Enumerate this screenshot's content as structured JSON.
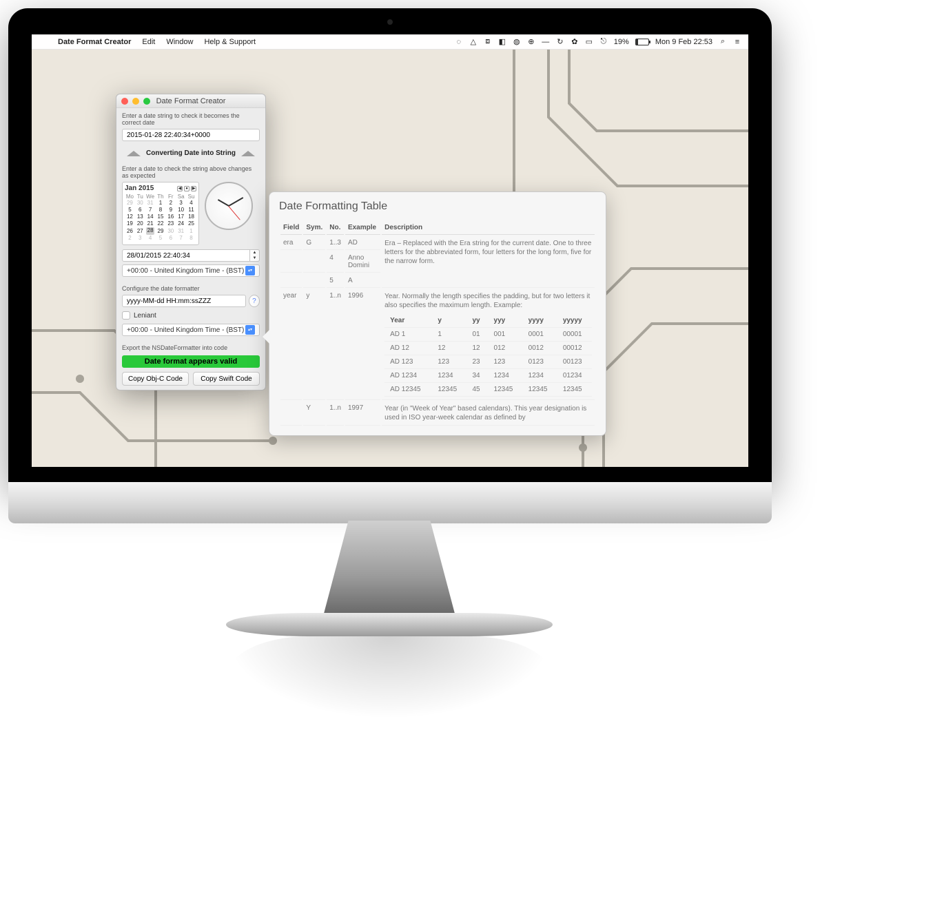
{
  "menubar": {
    "app_name": "Date Format Creator",
    "items": [
      "Edit",
      "Window",
      "Help & Support"
    ],
    "battery_pct": "19%",
    "datetime": "Mon 9 Feb  22:53"
  },
  "window": {
    "title": "Date Format Creator",
    "check_label": "Enter a date string to check it becomes the correct date",
    "check_value": "2015-01-28 22:40:34+0000",
    "divider_label": "Converting Date into String",
    "enter_date_label": "Enter a date to check the string above changes as expected",
    "calendar": {
      "month": "Jan 2015",
      "dow": [
        "Mo",
        "Tu",
        "We",
        "Th",
        "Fr",
        "Sa",
        "Su"
      ],
      "weeks": [
        [
          "29",
          "30",
          "31",
          "1",
          "2",
          "3",
          "4"
        ],
        [
          "5",
          "6",
          "7",
          "8",
          "9",
          "10",
          "11"
        ],
        [
          "12",
          "13",
          "14",
          "15",
          "16",
          "17",
          "18"
        ],
        [
          "19",
          "20",
          "21",
          "22",
          "23",
          "24",
          "25"
        ],
        [
          "26",
          "27",
          "28",
          "29",
          "30",
          "31",
          "1"
        ],
        [
          "2",
          "3",
          "4",
          "5",
          "6",
          "7",
          "8"
        ]
      ],
      "dim_leading": 3,
      "dim_trailing_start": 33,
      "selected": "28"
    },
    "date_value": "28/01/2015 22:40:34",
    "timezone1": "+00:00 - United Kingdom Time - (BST)",
    "configure_label": "Configure the date formatter",
    "format_value": "yyyy-MM-dd HH:mm:ssZZZ",
    "leniant_label": "Leniant",
    "timezone2": "+00:00 - United Kingdom Time - (BST)",
    "export_label": "Export the NSDateFormatter into code",
    "valid_label": "Date format appears valid",
    "copy_objc": "Copy Obj-C Code",
    "copy_swift": "Copy Swift Code"
  },
  "popover": {
    "title": "Date Formatting Table",
    "headers": {
      "field": "Field",
      "sym": "Sym.",
      "no": "No.",
      "ex": "Example",
      "desc": "Description"
    },
    "rows": [
      {
        "field": "era",
        "sym": "G",
        "entries": [
          {
            "no": "1..3",
            "ex": "AD"
          },
          {
            "no": "4",
            "ex": "Anno Domini"
          },
          {
            "no": "5",
            "ex": "A"
          }
        ],
        "desc": "Era – Replaced with the Era string for the current date. One to three letters for the abbreviated form, four letters for the long form, five for the narrow form."
      },
      {
        "field": "year",
        "sym": "y",
        "entries": [
          {
            "no": "1..n",
            "ex": "1996"
          }
        ],
        "desc": "Year. Normally the length specifies the padding, but for two letters it also specifies the maximum length. Example:"
      },
      {
        "field": "",
        "sym": "Y",
        "entries": [
          {
            "no": "1..n",
            "ex": "1997"
          }
        ],
        "desc": "Year (in \"Week of Year\" based calendars). This year designation is used in ISO year-week calendar as defined by"
      }
    ],
    "year_subtable": {
      "headers": [
        "Year",
        "y",
        "yy",
        "yyy",
        "yyyy",
        "yyyyy"
      ],
      "rows": [
        [
          "AD 1",
          "1",
          "01",
          "001",
          "0001",
          "00001"
        ],
        [
          "AD 12",
          "12",
          "12",
          "012",
          "0012",
          "00012"
        ],
        [
          "AD 123",
          "123",
          "23",
          "123",
          "0123",
          "00123"
        ],
        [
          "AD 1234",
          "1234",
          "34",
          "1234",
          "1234",
          "01234"
        ],
        [
          "AD 12345",
          "12345",
          "45",
          "12345",
          "12345",
          "12345"
        ]
      ]
    }
  }
}
